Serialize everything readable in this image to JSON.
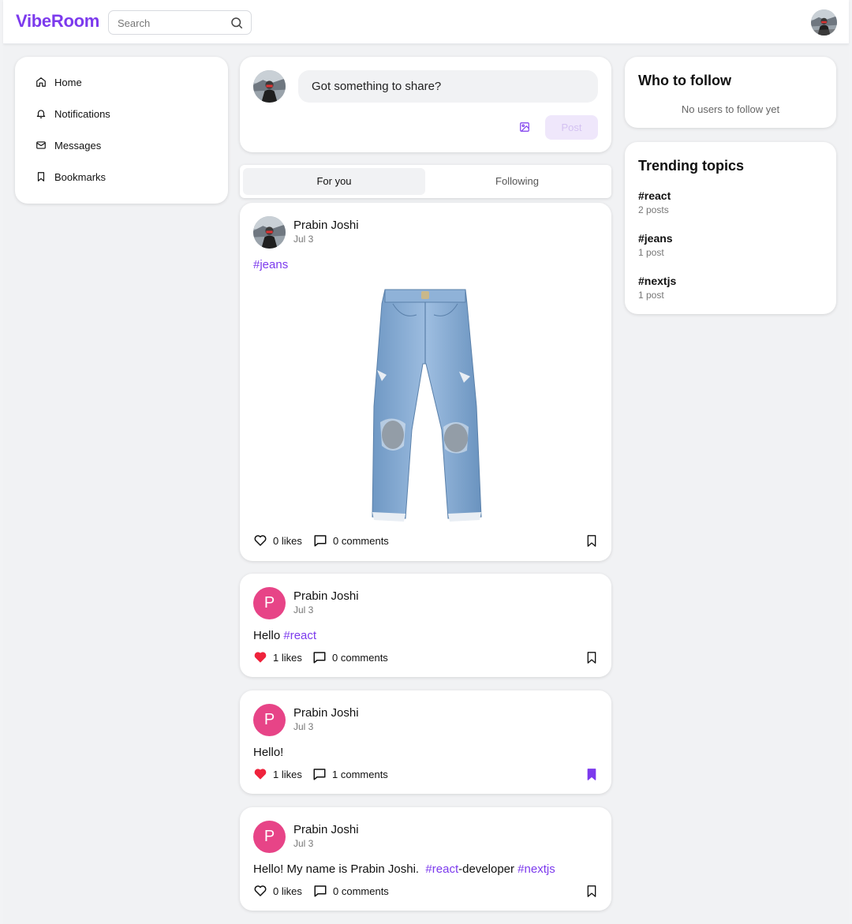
{
  "header": {
    "logo": "VibeRoom",
    "search_placeholder": "Search"
  },
  "nav": {
    "items": [
      {
        "label": "Home",
        "icon": "home-icon"
      },
      {
        "label": "Notifications",
        "icon": "bell-icon"
      },
      {
        "label": "Messages",
        "icon": "mail-icon"
      },
      {
        "label": "Bookmarks",
        "icon": "bookmark-icon"
      }
    ]
  },
  "composer": {
    "placeholder": "Got something to share?",
    "post_label": "Post"
  },
  "tabs": [
    {
      "label": "For you",
      "active": true
    },
    {
      "label": "Following",
      "active": false
    }
  ],
  "posts": [
    {
      "author": "Prabin Joshi",
      "date": "Jul 3",
      "text_tag": "#jeans",
      "likes": "0 likes",
      "comments": "0 comments",
      "liked": false,
      "bookmarked": false,
      "image": "jeans"
    },
    {
      "author": "Prabin Joshi",
      "avatar_letter": "P",
      "date": "Jul 3",
      "text_prefix": "Hello ",
      "text_tag": "#react",
      "likes": "1 likes",
      "comments": "0 comments",
      "liked": true,
      "bookmarked": false
    },
    {
      "author": "Prabin Joshi",
      "avatar_letter": "P",
      "date": "Jul 3",
      "text": "Hello!",
      "likes": "1 likes",
      "comments": "1 comments",
      "liked": true,
      "bookmarked": true
    },
    {
      "author": "Prabin Joshi",
      "avatar_letter": "P",
      "date": "Jul 3",
      "text_prefix": "Hello! My name is Prabin Joshi.  ",
      "tag1": "#react",
      "mid": "-developer ",
      "tag2": "#nextjs",
      "likes": "0 likes",
      "comments": "0 comments",
      "liked": false,
      "bookmarked": false
    }
  ],
  "who_to_follow": {
    "title": "Who to follow",
    "empty": "No users to follow yet"
  },
  "trending": {
    "title": "Trending topics",
    "topics": [
      {
        "tag": "#react",
        "count": "2 posts"
      },
      {
        "tag": "#jeans",
        "count": "1 post"
      },
      {
        "tag": "#nextjs",
        "count": "1 post"
      }
    ]
  },
  "colors": {
    "accent": "#7c3aed",
    "avatar_bg": "#e74487",
    "like_red": "#ef233c",
    "page_bg": "#f1f2f4"
  }
}
